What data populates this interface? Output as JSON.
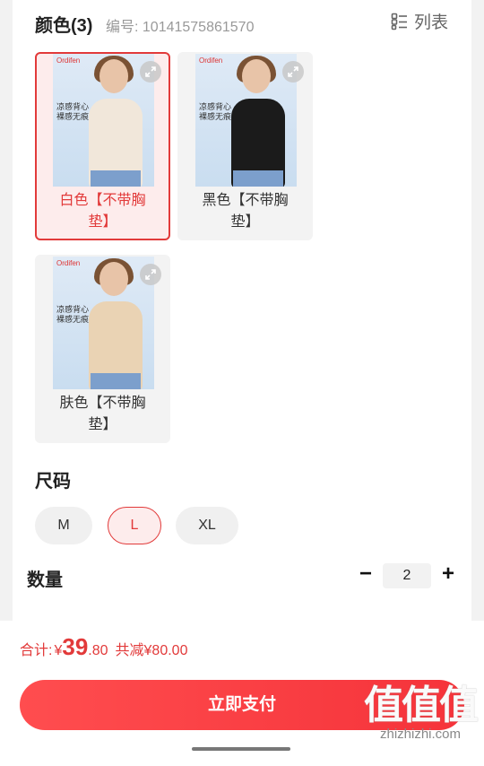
{
  "header": {
    "color_title": "颜色(3)",
    "sku_id": "编号: 10141575861570",
    "list_label": "列表"
  },
  "colors": [
    {
      "label": "白色【不带胸垫】",
      "brand": "Ordifen",
      "promo": "凉感背心 裸感无痕",
      "garment": "#f1e7da",
      "selected": true
    },
    {
      "label": "黑色【不带胸垫】",
      "brand": "Ordifen",
      "promo": "凉感背心 裸感无痕",
      "garment": "#1b1b1b",
      "selected": false
    },
    {
      "label": "肤色【不带胸垫】",
      "brand": "Ordifen",
      "promo": "凉感背心 裸感无痕",
      "garment": "#ead3b4",
      "selected": false
    }
  ],
  "size": {
    "title": "尺码",
    "options": [
      "M",
      "L",
      "XL"
    ],
    "selected": "L"
  },
  "quantity": {
    "title": "数量",
    "minus": "−",
    "value": "2",
    "plus": "+"
  },
  "footer": {
    "total_label": "合计:",
    "currency": "¥",
    "price_int": "39",
    "price_dec": ".80",
    "saving": "共减¥80.00",
    "pay_label": "立即支付"
  },
  "watermark": {
    "big": "值值值",
    "small": "zhizhizhi.com"
  },
  "colors_theme": {
    "accent": "#e23a3a"
  }
}
